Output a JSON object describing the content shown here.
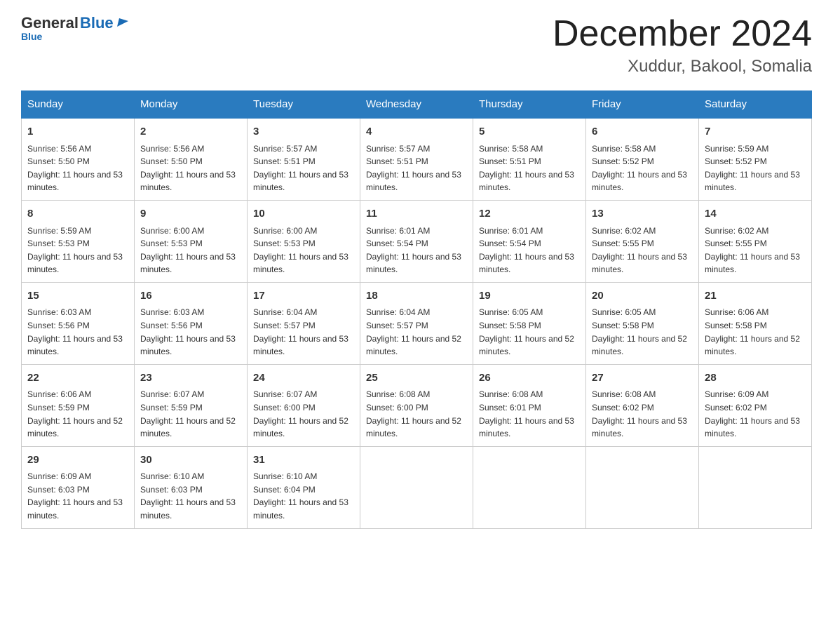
{
  "logo": {
    "general": "General",
    "blue": "Blue",
    "subtitle": "Blue"
  },
  "header": {
    "title": "December 2024",
    "location": "Xuddur, Bakool, Somalia"
  },
  "days_of_week": [
    "Sunday",
    "Monday",
    "Tuesday",
    "Wednesday",
    "Thursday",
    "Friday",
    "Saturday"
  ],
  "weeks": [
    [
      {
        "day": "1",
        "sunrise": "5:56 AM",
        "sunset": "5:50 PM",
        "daylight": "11 hours and 53 minutes."
      },
      {
        "day": "2",
        "sunrise": "5:56 AM",
        "sunset": "5:50 PM",
        "daylight": "11 hours and 53 minutes."
      },
      {
        "day": "3",
        "sunrise": "5:57 AM",
        "sunset": "5:51 PM",
        "daylight": "11 hours and 53 minutes."
      },
      {
        "day": "4",
        "sunrise": "5:57 AM",
        "sunset": "5:51 PM",
        "daylight": "11 hours and 53 minutes."
      },
      {
        "day": "5",
        "sunrise": "5:58 AM",
        "sunset": "5:51 PM",
        "daylight": "11 hours and 53 minutes."
      },
      {
        "day": "6",
        "sunrise": "5:58 AM",
        "sunset": "5:52 PM",
        "daylight": "11 hours and 53 minutes."
      },
      {
        "day": "7",
        "sunrise": "5:59 AM",
        "sunset": "5:52 PM",
        "daylight": "11 hours and 53 minutes."
      }
    ],
    [
      {
        "day": "8",
        "sunrise": "5:59 AM",
        "sunset": "5:53 PM",
        "daylight": "11 hours and 53 minutes."
      },
      {
        "day": "9",
        "sunrise": "6:00 AM",
        "sunset": "5:53 PM",
        "daylight": "11 hours and 53 minutes."
      },
      {
        "day": "10",
        "sunrise": "6:00 AM",
        "sunset": "5:53 PM",
        "daylight": "11 hours and 53 minutes."
      },
      {
        "day": "11",
        "sunrise": "6:01 AM",
        "sunset": "5:54 PM",
        "daylight": "11 hours and 53 minutes."
      },
      {
        "day": "12",
        "sunrise": "6:01 AM",
        "sunset": "5:54 PM",
        "daylight": "11 hours and 53 minutes."
      },
      {
        "day": "13",
        "sunrise": "6:02 AM",
        "sunset": "5:55 PM",
        "daylight": "11 hours and 53 minutes."
      },
      {
        "day": "14",
        "sunrise": "6:02 AM",
        "sunset": "5:55 PM",
        "daylight": "11 hours and 53 minutes."
      }
    ],
    [
      {
        "day": "15",
        "sunrise": "6:03 AM",
        "sunset": "5:56 PM",
        "daylight": "11 hours and 53 minutes."
      },
      {
        "day": "16",
        "sunrise": "6:03 AM",
        "sunset": "5:56 PM",
        "daylight": "11 hours and 53 minutes."
      },
      {
        "day": "17",
        "sunrise": "6:04 AM",
        "sunset": "5:57 PM",
        "daylight": "11 hours and 53 minutes."
      },
      {
        "day": "18",
        "sunrise": "6:04 AM",
        "sunset": "5:57 PM",
        "daylight": "11 hours and 52 minutes."
      },
      {
        "day": "19",
        "sunrise": "6:05 AM",
        "sunset": "5:58 PM",
        "daylight": "11 hours and 52 minutes."
      },
      {
        "day": "20",
        "sunrise": "6:05 AM",
        "sunset": "5:58 PM",
        "daylight": "11 hours and 52 minutes."
      },
      {
        "day": "21",
        "sunrise": "6:06 AM",
        "sunset": "5:58 PM",
        "daylight": "11 hours and 52 minutes."
      }
    ],
    [
      {
        "day": "22",
        "sunrise": "6:06 AM",
        "sunset": "5:59 PM",
        "daylight": "11 hours and 52 minutes."
      },
      {
        "day": "23",
        "sunrise": "6:07 AM",
        "sunset": "5:59 PM",
        "daylight": "11 hours and 52 minutes."
      },
      {
        "day": "24",
        "sunrise": "6:07 AM",
        "sunset": "6:00 PM",
        "daylight": "11 hours and 52 minutes."
      },
      {
        "day": "25",
        "sunrise": "6:08 AM",
        "sunset": "6:00 PM",
        "daylight": "11 hours and 52 minutes."
      },
      {
        "day": "26",
        "sunrise": "6:08 AM",
        "sunset": "6:01 PM",
        "daylight": "11 hours and 53 minutes."
      },
      {
        "day": "27",
        "sunrise": "6:08 AM",
        "sunset": "6:02 PM",
        "daylight": "11 hours and 53 minutes."
      },
      {
        "day": "28",
        "sunrise": "6:09 AM",
        "sunset": "6:02 PM",
        "daylight": "11 hours and 53 minutes."
      }
    ],
    [
      {
        "day": "29",
        "sunrise": "6:09 AM",
        "sunset": "6:03 PM",
        "daylight": "11 hours and 53 minutes."
      },
      {
        "day": "30",
        "sunrise": "6:10 AM",
        "sunset": "6:03 PM",
        "daylight": "11 hours and 53 minutes."
      },
      {
        "day": "31",
        "sunrise": "6:10 AM",
        "sunset": "6:04 PM",
        "daylight": "11 hours and 53 minutes."
      },
      null,
      null,
      null,
      null
    ]
  ]
}
